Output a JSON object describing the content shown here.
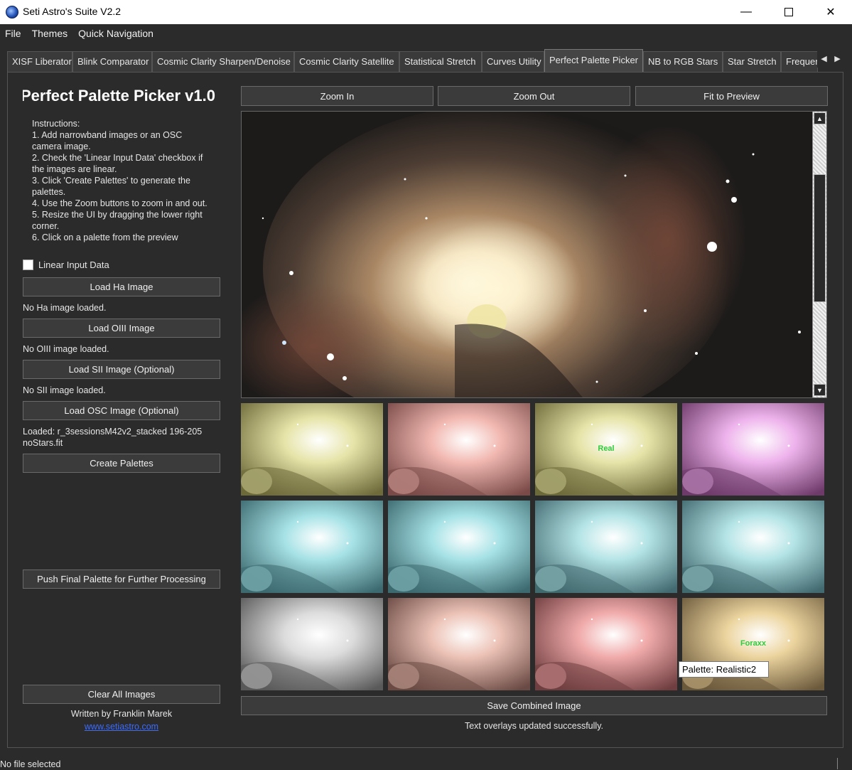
{
  "window": {
    "title": "Seti Astro's Suite V2.2",
    "minimize_label": "—",
    "close_label": "✕"
  },
  "menu": [
    "File",
    "Themes",
    "Quick Navigation"
  ],
  "tabs": [
    {
      "label": "XISF Liberator",
      "active": false
    },
    {
      "label": "Blink Comparator",
      "active": false
    },
    {
      "label": "Cosmic Clarity Sharpen/Denoise",
      "active": false
    },
    {
      "label": "Cosmic Clarity Satellite",
      "active": false
    },
    {
      "label": "Statistical Stretch",
      "active": false
    },
    {
      "label": "Curves Utility",
      "active": false
    },
    {
      "label": "Perfect Palette Picker",
      "active": true
    },
    {
      "label": "NB to RGB Stars",
      "active": false
    },
    {
      "label": "Star Stretch",
      "active": false
    },
    {
      "label": "Frequer",
      "active": false
    }
  ],
  "tab_scroll": {
    "left": "◀",
    "right": "▶"
  },
  "left_panel": {
    "title": "Perfect Palette Picker v1.0",
    "instructions": [
      "Instructions:",
      "1. Add narrowband images or an OSC camera image.",
      "2. Check the 'Linear Input Data' checkbox if the images are linear.",
      "3. Click 'Create Palettes' to generate the palettes.",
      "4. Use the Zoom buttons to zoom in and out.",
      "5. Resize the UI by dragging the lower right corner.",
      "6. Click on a palette from the preview"
    ],
    "linear_input_label": "Linear Input Data",
    "linear_input_checked": false,
    "load_ha_label": "Load Ha Image",
    "ha_status": "No Ha image loaded.",
    "load_oiii_label": "Load OIII Image",
    "oiii_status": "No OIII image loaded.",
    "load_sii_label": "Load SII Image (Optional)",
    "sii_status": "No SII image loaded.",
    "load_osc_label": "Load OSC Image (Optional)",
    "osc_status": "Loaded: r_3sessionsM42v2_stacked 196-205 noStars.fit",
    "create_palettes_label": "Create Palettes",
    "push_final_label": "Push Final Palette for Further Processing",
    "clear_all_label": "Clear All Images",
    "credit": "Written by Franklin Marek",
    "credit_link": "www.setiastro.com"
  },
  "zoom": {
    "zoom_in_label": "Zoom In",
    "zoom_out_label": "Zoom Out",
    "fit_label": "Fit to Preview"
  },
  "thumbnails": [
    {
      "tint": "#e6e4a8",
      "shadow": "#6e6a3a",
      "label": ""
    },
    {
      "tint": "#f2b9b2",
      "shadow": "#7a4a48",
      "label": ""
    },
    {
      "tint": "#e6e4a8",
      "shadow": "#6e6a3a",
      "label": "Real"
    },
    {
      "tint": "#eeb3ec",
      "shadow": "#6e3a6a",
      "label": ""
    },
    {
      "tint": "#a6e2e6",
      "shadow": "#3c6a70",
      "label": ""
    },
    {
      "tint": "#a6e2e6",
      "shadow": "#3c6a70",
      "label": ""
    },
    {
      "tint": "#b4e4e6",
      "shadow": "#426a70",
      "label": ""
    },
    {
      "tint": "#b4e4e6",
      "shadow": "#426a70",
      "label": ""
    },
    {
      "tint": "#dcdcdc",
      "shadow": "#5a5a5a",
      "label": ""
    },
    {
      "tint": "#ecc2b6",
      "shadow": "#6a4a44",
      "label": ""
    },
    {
      "tint": "#f0aaaa",
      "shadow": "#703e40",
      "label": ""
    },
    {
      "tint": "#ecd49e",
      "shadow": "#6c5a3c",
      "label": "Foraxx"
    }
  ],
  "tooltip": "Palette: Realistic2",
  "save_combined_label": "Save Combined Image",
  "overlay_status": "Text overlays updated successfully.",
  "statusbar": "No file selected",
  "colors": {
    "background": "#2b2b2b",
    "button": "#3b3b3b",
    "label_green": "#2ecc40",
    "link": "#3b6bff"
  }
}
